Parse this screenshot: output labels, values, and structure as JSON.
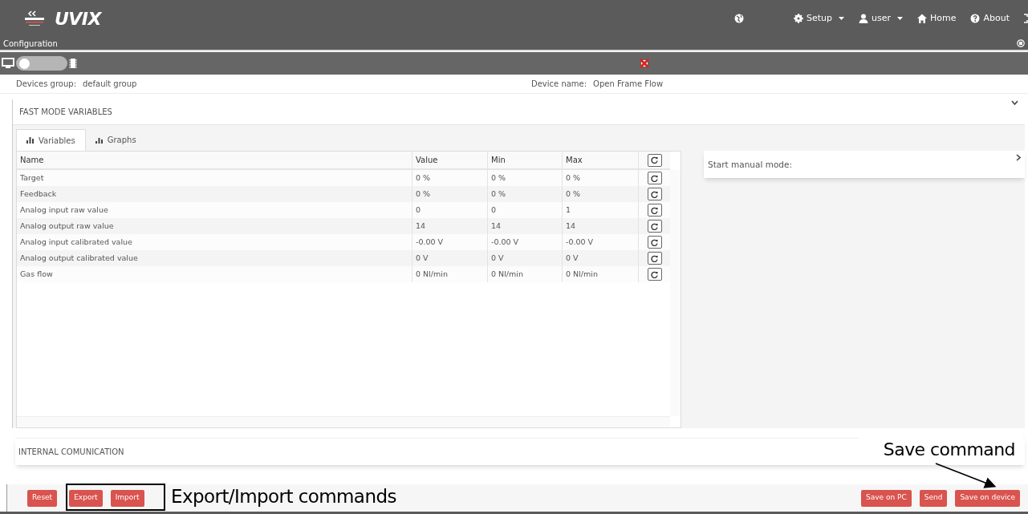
{
  "navbar": {
    "logo": "UVIX",
    "menu": [
      {
        "kind": "globe",
        "has_menu": false
      },
      {
        "kind": "gear",
        "label": "Setup",
        "has_menu": true
      },
      {
        "kind": "user",
        "label": "user",
        "has_menu": true
      },
      {
        "kind": "home",
        "label": "Home",
        "has_menu": false
      },
      {
        "kind": "help",
        "label": "About",
        "has_menu": false
      }
    ]
  },
  "config_bar": {
    "title": "Configuration"
  },
  "toolbar": {
    "mode_switch": {
      "on": false
    },
    "connected": false
  },
  "device_info": {
    "group_label": "Devices group:",
    "group": "default group",
    "name_label": "Device name:",
    "name": "Open Frame Flow"
  },
  "fast_mode": {
    "title": "FAST MODE VARIABLES",
    "expanded": true,
    "tabs": [
      {
        "label": "Variables",
        "selected": true
      },
      {
        "label": "Graphs",
        "selected": false
      }
    ],
    "table": {
      "columns": [
        "Name",
        "Value",
        "Min",
        "Max"
      ],
      "rows": [
        [
          "Target",
          "0 %",
          "0 %",
          "0 %"
        ],
        [
          "Feedback",
          "0 %",
          "0 %",
          "0 %"
        ],
        [
          "Analog input raw value",
          "0",
          "0",
          "1"
        ],
        [
          "Analog output raw value",
          "14",
          "14",
          "14"
        ],
        [
          "Analog input calibrated value",
          "-0.00 V",
          "-0.00 V",
          "-0.00 V"
        ],
        [
          "Analog output calibrated value",
          "0 V",
          "0 V",
          "0 V"
        ],
        [
          "Gas flow",
          "0 Nl/min",
          "0 Nl/min",
          "0 Nl/min"
        ]
      ]
    },
    "side_panel": {
      "title": "Start manual mode:",
      "expanded": false
    }
  },
  "internal_communication": {
    "title": "INTERNAL COMUNICATION"
  },
  "buttons_left": [
    "Reset",
    "Export",
    "Import"
  ],
  "buttons_right": [
    "Save on PC",
    "Send",
    "Save on device"
  ],
  "annotations": [
    "Export/Import commands",
    "Save command"
  ]
}
